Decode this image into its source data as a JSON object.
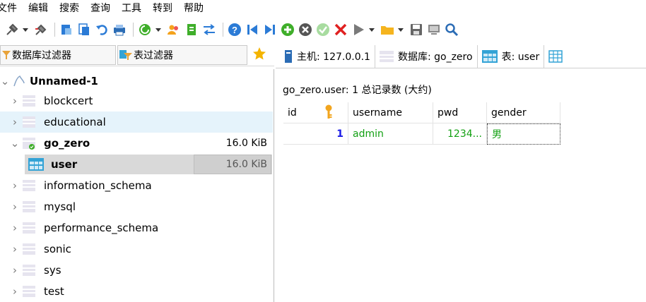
{
  "menubar": {
    "items": [
      "文件",
      "编辑",
      "搜索",
      "查询",
      "工具",
      "转到",
      "帮助"
    ]
  },
  "toolbar": {
    "icons": [
      "connect-icon",
      "disconnect-icon",
      "new-table-icon",
      "copy-table-icon",
      "undo-icon",
      "print-icon",
      "refresh-icon",
      "user-manager-icon",
      "export-icon",
      "compare-icon",
      "help-icon",
      "first-record-icon",
      "last-record-icon",
      "add-record-icon",
      "delete-record-icon",
      "post-record-icon",
      "cancel-record-icon",
      "run-query-icon",
      "folder-icon",
      "save-icon",
      "server-icon",
      "search-icon"
    ]
  },
  "filters": {
    "database_filter": "数据库过滤器",
    "table_filter": "表过滤器"
  },
  "tabs": [
    {
      "label": "主机: 127.0.0.1",
      "icon": "host-icon"
    },
    {
      "label": "数据库: go_zero",
      "icon": "database-icon"
    },
    {
      "label": "表: user",
      "icon": "table-icon"
    },
    {
      "label": "",
      "icon": "data-grid-icon"
    }
  ],
  "tree": {
    "root": "Unnamed-1",
    "databases": [
      {
        "name": "blockcert",
        "size": ""
      },
      {
        "name": "educational",
        "size": ""
      },
      {
        "name": "go_zero",
        "size": "16.0 KiB",
        "expanded": true
      },
      {
        "name": "user",
        "size": "16.0 KiB",
        "is_table": true
      },
      {
        "name": "information_schema",
        "size": ""
      },
      {
        "name": "mysql",
        "size": ""
      },
      {
        "name": "performance_schema",
        "size": ""
      },
      {
        "name": "sonic",
        "size": ""
      },
      {
        "name": "sys",
        "size": ""
      },
      {
        "name": "test",
        "size": ""
      }
    ]
  },
  "records_label": "go_zero.user: 1 总记录数 (大约)",
  "grid": {
    "columns": [
      "id",
      "username",
      "pwd",
      "gender"
    ],
    "rows": [
      {
        "id": "1",
        "username": "admin",
        "pwd": "1234...",
        "gender": "男"
      }
    ]
  },
  "colors": {
    "accent_blue": "#1a1ae6",
    "value_green": "#12a012",
    "selection_gray": "#d9d9d9",
    "hover_blue": "#e5f3fb"
  }
}
